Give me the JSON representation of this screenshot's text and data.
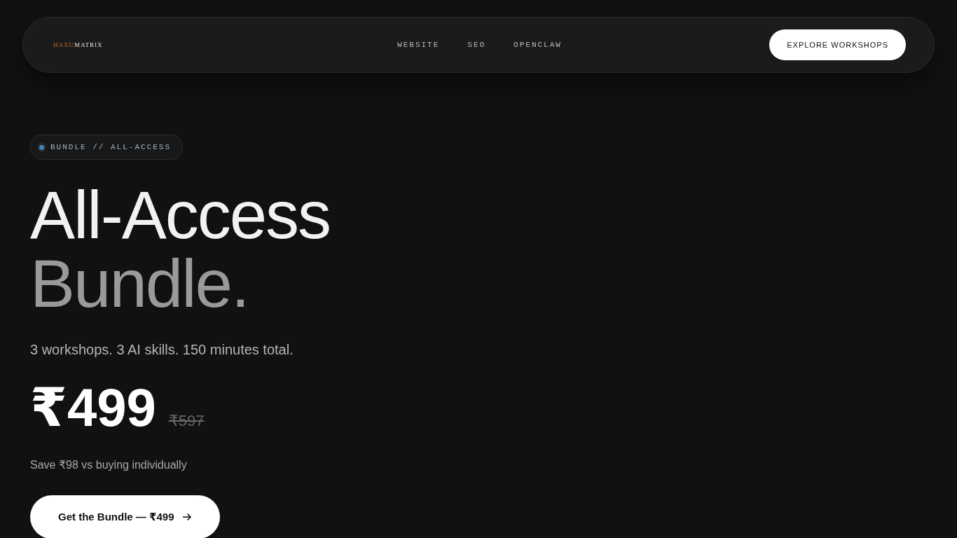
{
  "nav": {
    "logo": {
      "accent": "HAXU",
      "rest": "MATRIX"
    },
    "links": [
      "WEBSITE",
      "SEO",
      "OPENCLAW"
    ],
    "cta": "EXPLORE WORKSHOPS"
  },
  "hero": {
    "badge": "BUNDLE // ALL-ACCESS",
    "title_line_1": "All-Access",
    "title_line_2": "Bundle.",
    "subtitle": "3 workshops. 3 AI skills. 150 minutes total.",
    "price": "₹499",
    "original_price": "₹597",
    "savings": "Save ₹98 vs buying individually",
    "button": "Get the Bundle — ₹499"
  }
}
